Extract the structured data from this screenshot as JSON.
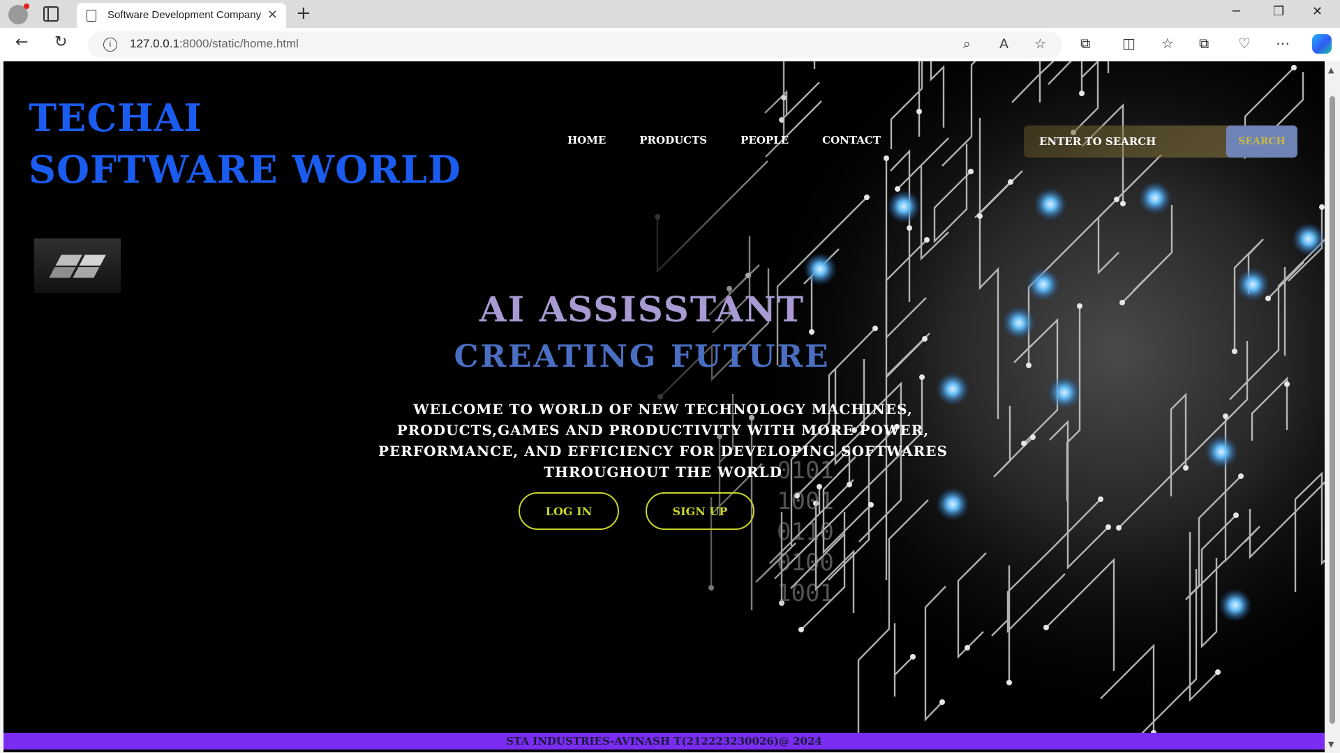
{
  "browser": {
    "tab_title": "Software Development Company",
    "tab_close": "×",
    "new_tab": "+",
    "url_host": "127.0.0.1",
    "url_rest": ":8000/static/home.html",
    "window_controls": {
      "minimize": "─",
      "restore": "❐",
      "close": "✕"
    },
    "nav": {
      "back": "←",
      "reload": "↻"
    },
    "icons": {
      "zoom": "⌕",
      "read_aloud": "A",
      "favorite": "☆",
      "extensions": "⧉",
      "split": "◫",
      "favorites": "☆",
      "collections": "⧉",
      "performance": "♡",
      "more": "⋯"
    }
  },
  "page": {
    "brand": "TECHAI SOFTWARE WORLD",
    "nav": [
      "HOME",
      "PRODUCTS",
      "PEOPLE",
      "CONTACT"
    ],
    "search": {
      "placeholder": "ENTER TO SEARCH",
      "button": "SEARCH"
    },
    "hero": {
      "title1": "AI ASSISSTANT",
      "title2": "CREATING FUTURE",
      "text": "WELCOME TO WORLD OF NEW TECHNOLOGY MACHINES, PRODUCTS,GAMES AND PRODUCTIVITY WITH MORE POWER, PERFORMANCE, AND EFFICIENCY FOR DEVELOPING SOFTWARES THROUGHOUT THE WORLD"
    },
    "buttons": {
      "login": "LOG IN",
      "signup": "SIGN UP"
    },
    "footer": "STA INDUSTRIES-AVINASH T(212223230026)@ 2024",
    "binary_rows": [
      "0101",
      "1001",
      "0110",
      "0100",
      "1001"
    ]
  },
  "colors": {
    "brand": "#1a5cf0",
    "title1": "#a89ad2",
    "title2": "#4a6fc2",
    "button_border": "#c9d52a",
    "footer_bg": "#7a2cf0",
    "search_button_bg": "#6f83b6"
  }
}
